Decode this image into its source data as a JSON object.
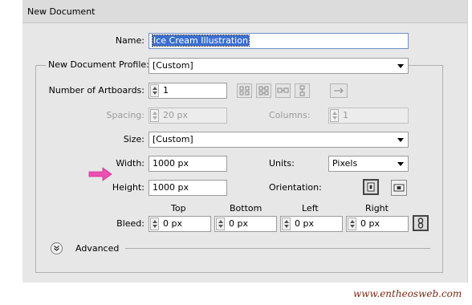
{
  "window": {
    "title": "New Document"
  },
  "name": {
    "label": "Name:",
    "value": "Ice Cream Illustration"
  },
  "profile": {
    "label": "New Document Profile:",
    "value": "[Custom]"
  },
  "artboards": {
    "label": "Number of Artboards:",
    "value": "1"
  },
  "spacing": {
    "label": "Spacing:",
    "value": "20 px"
  },
  "columns": {
    "label": "Columns:",
    "value": "1"
  },
  "size": {
    "label": "Size:",
    "value": "[Custom]"
  },
  "width": {
    "label": "Width:",
    "value": "1000 px"
  },
  "height": {
    "label": "Height:",
    "value": "1000 px"
  },
  "units": {
    "label": "Units:",
    "value": "Pixels"
  },
  "orientation": {
    "label": "Orientation:",
    "selected": "portrait"
  },
  "bleed": {
    "label": "Bleed:",
    "top": {
      "label": "Top",
      "value": "0 px"
    },
    "bottom": {
      "label": "Bottom",
      "value": "0 px"
    },
    "left": {
      "label": "Left",
      "value": "0 px"
    },
    "right": {
      "label": "Right",
      "value": "0 px"
    }
  },
  "advanced": {
    "label": "Advanced"
  },
  "watermark": "www.entheosweb.com",
  "colors": {
    "arrow": "#ee4fb3",
    "selection": "#3b6fd1",
    "watermark": "#7a2a18"
  }
}
